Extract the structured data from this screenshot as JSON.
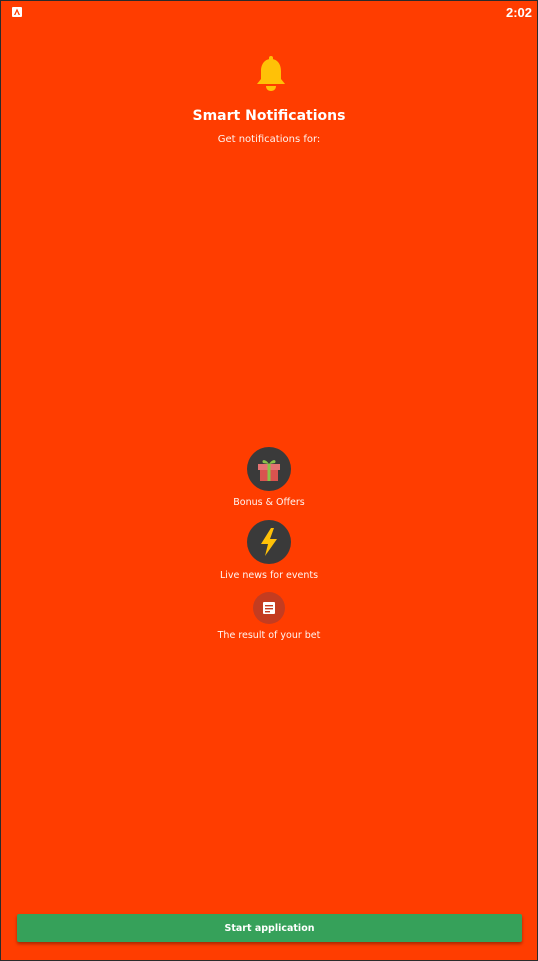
{
  "status_bar": {
    "time": "2:02",
    "app_icon": "android-notification-icon"
  },
  "header": {
    "icon": "bell-icon",
    "title": "Smart Notifications",
    "subtitle": "Get notifications for:"
  },
  "features": [
    {
      "icon": "gift-icon",
      "label": "Bonus & Offers"
    },
    {
      "icon": "lightning-icon",
      "label": "Live news for events"
    },
    {
      "icon": "receipt-icon",
      "label": "The result of your bet"
    }
  ],
  "footer": {
    "start_label": "Start application"
  },
  "colors": {
    "background": "#ff3d00",
    "button": "#36a15a",
    "bell": "#ffc107",
    "icon_circle": "#3a3a3a"
  }
}
